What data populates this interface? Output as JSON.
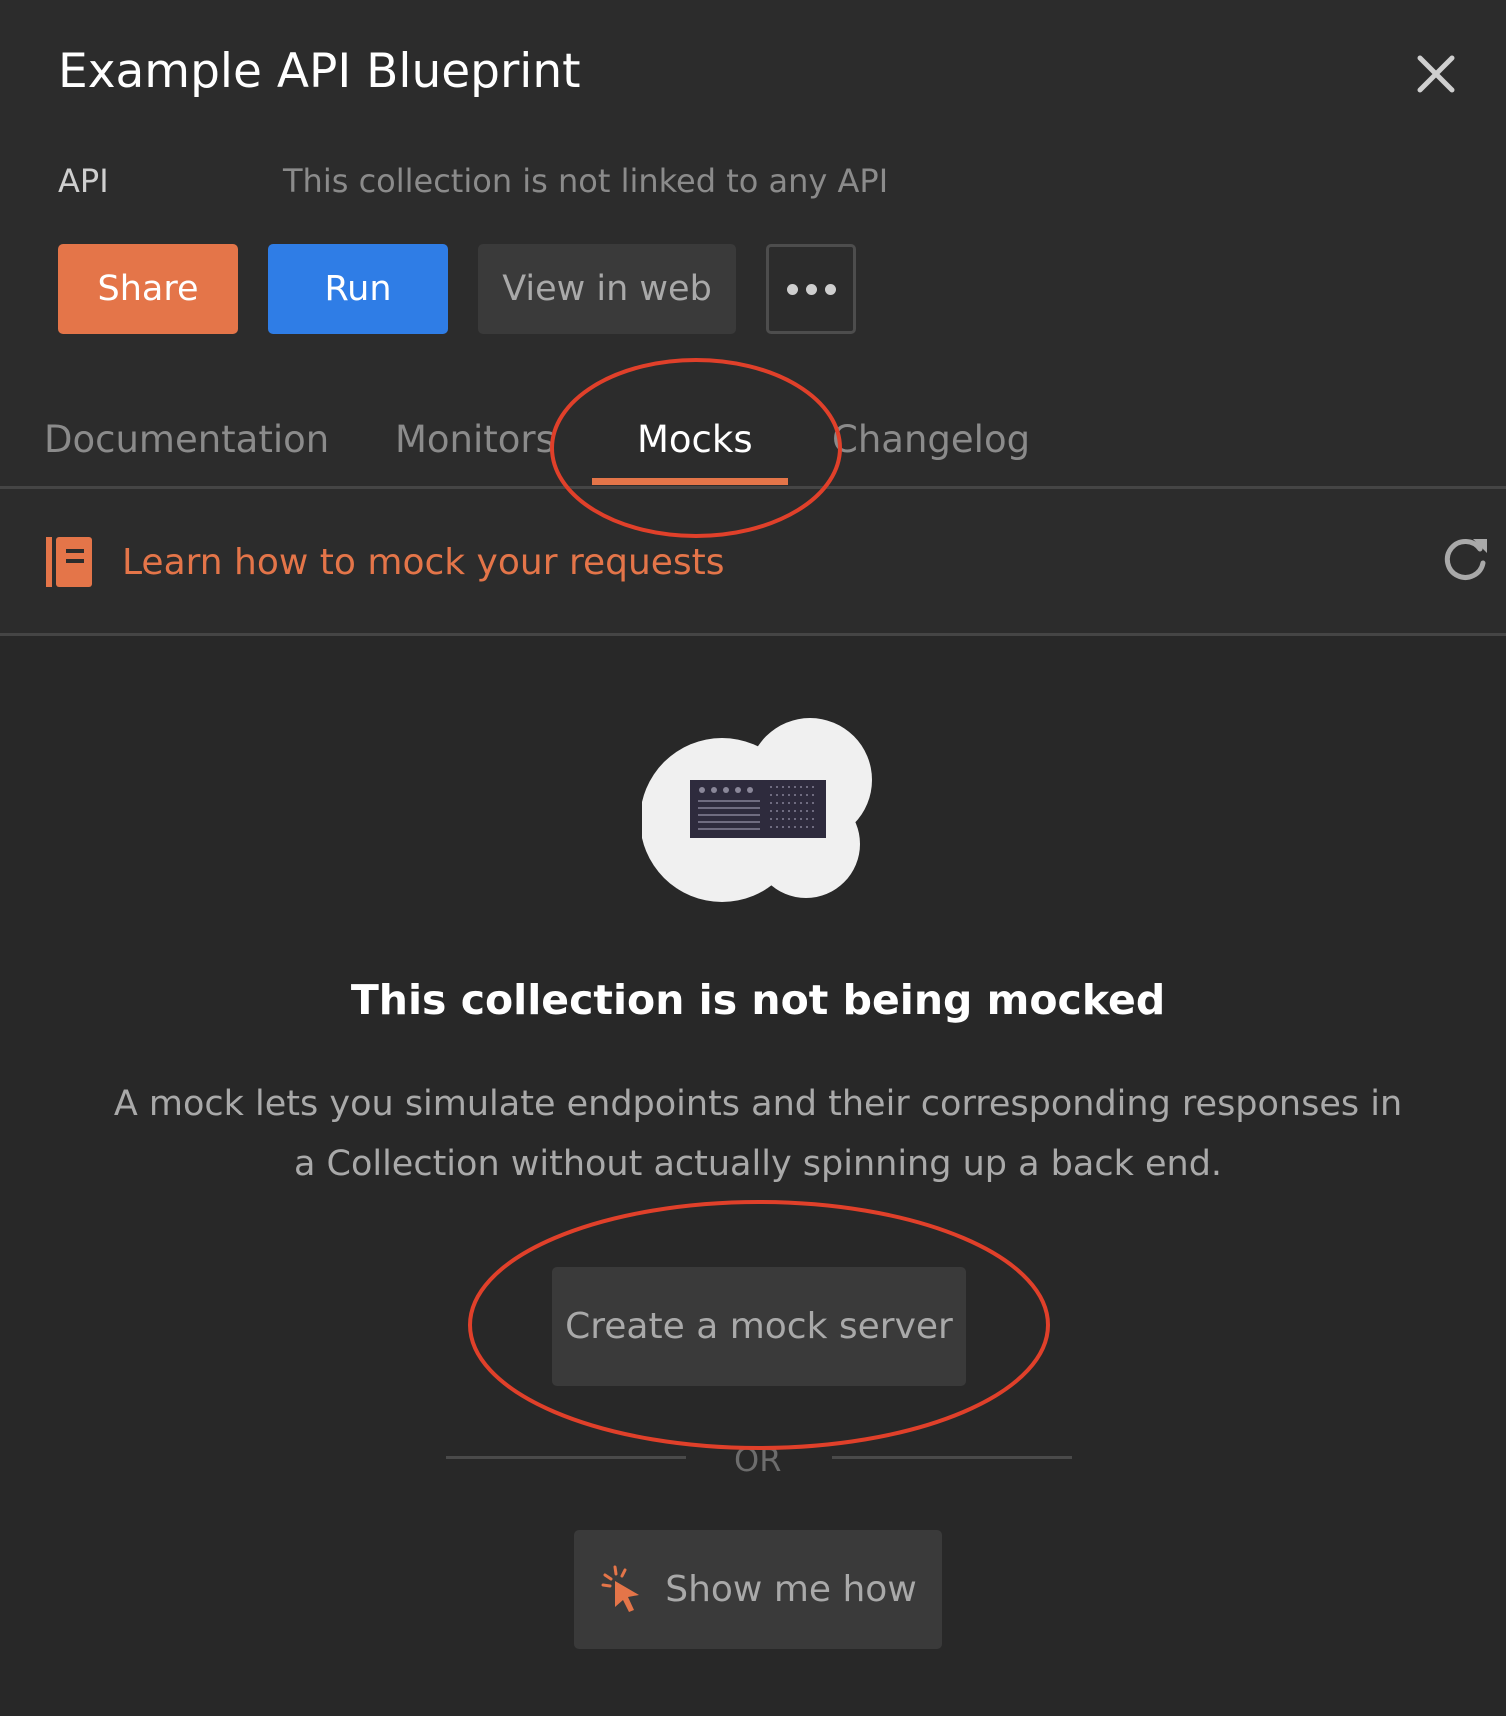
{
  "header": {
    "title": "Example API Blueprint",
    "api_label": "API",
    "api_value": "This collection is not linked to any API"
  },
  "actions": {
    "share_label": "Share",
    "run_label": "Run",
    "view_web_label": "View in web",
    "more_icon": "more-horizontal-icon"
  },
  "tabs": [
    {
      "label": "Documentation",
      "active": false
    },
    {
      "label": "Monitors",
      "active": false
    },
    {
      "label": "Mocks",
      "active": true
    },
    {
      "label": "Changelog",
      "active": false
    }
  ],
  "learn": {
    "label": "Learn how to mock your requests",
    "icon": "book-icon",
    "refresh_icon": "refresh-icon"
  },
  "empty_state": {
    "title": "This collection is not being mocked",
    "description": "A mock lets you simulate endpoints and their corresponding responses in a Collection without actually spinning up a back end.",
    "create_label": "Create a mock server",
    "or_label": "OR",
    "show_label": "Show me how",
    "show_icon": "pointer-click-icon"
  },
  "colors": {
    "accent": "#e47549",
    "run_blue": "#2f7de6",
    "annotation_red": "#e0402a",
    "background": "#282828"
  }
}
